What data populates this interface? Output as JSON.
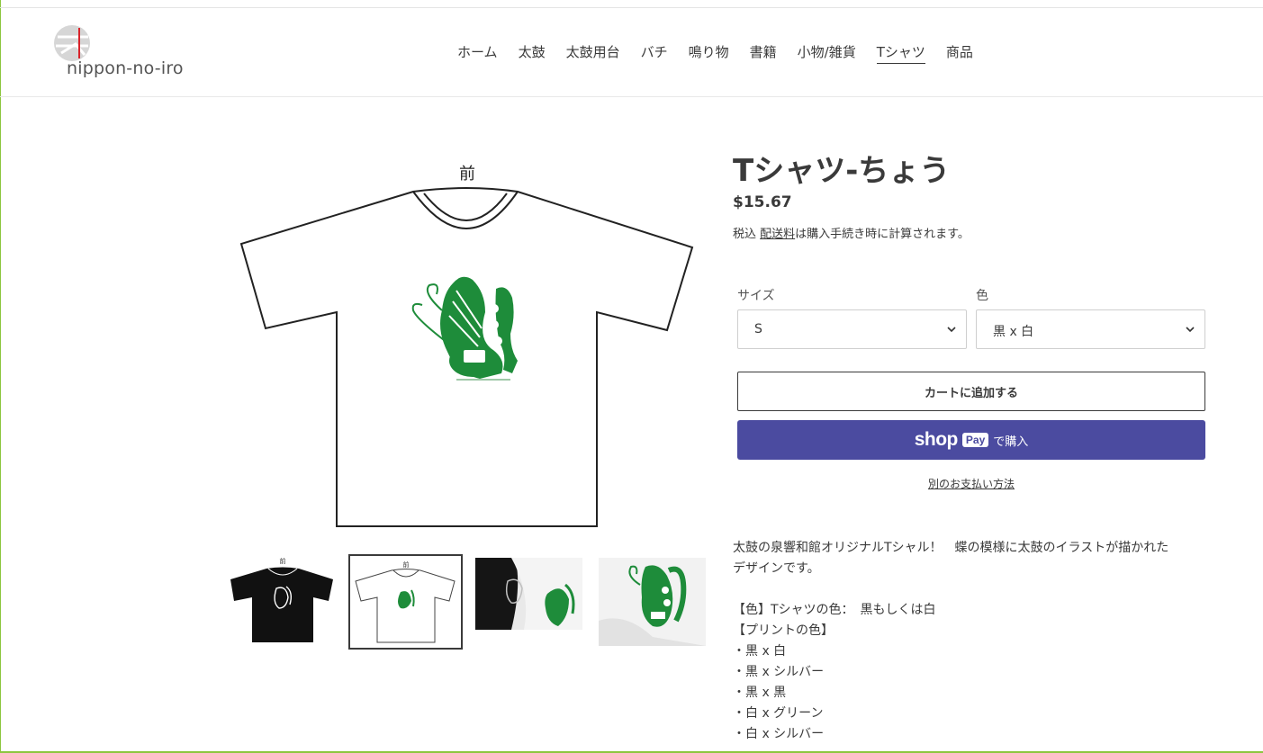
{
  "header": {
    "logo_text": "nippon-no-iro",
    "nav": [
      {
        "label": "ホーム"
      },
      {
        "label": "太鼓"
      },
      {
        "label": "太鼓用台"
      },
      {
        "label": "バチ"
      },
      {
        "label": "鳴り物"
      },
      {
        "label": "書籍"
      },
      {
        "label": "小物/雑貨"
      },
      {
        "label": "Tシャツ",
        "active": true
      },
      {
        "label": "商品"
      }
    ]
  },
  "gallery": {
    "main_caption": "前",
    "thumbnails": [
      {
        "name": "black-shirt-front",
        "selected": false
      },
      {
        "name": "white-shirt-front",
        "selected": true
      },
      {
        "name": "shirts-photo",
        "selected": false
      },
      {
        "name": "print-closeup-photo",
        "selected": false
      }
    ],
    "print_color": "#1e8c3a"
  },
  "product": {
    "title": "Tシャツ-ちょう",
    "price": "$15.67",
    "tax_prefix": "税込 ",
    "tax_link": "配送料",
    "tax_suffix": "は購入手続き時に計算されます。",
    "options": {
      "size_label": "サイズ",
      "size_value": "S",
      "color_label": "色",
      "color_value": "黒 x 白"
    },
    "add_to_cart": "カートに追加する",
    "shop_pay": {
      "shop": "shop",
      "pay": "Pay",
      "buy": "で購入"
    },
    "more_payment": "別のお支払い方法"
  },
  "description": {
    "lines": [
      " 太鼓の泉響和館オリジナルTシャル！　蝶の模様に太鼓のイラストが描かれた",
      "デザインです。",
      "",
      "【色】Tシャツの色：　黒もしくは白",
      "【プリントの色】",
      "・黒 x 白",
      "・黒 x シルバー",
      "・黒 x 黒",
      "・白 x グリーン",
      "・白 x シルバー"
    ]
  },
  "colors": {
    "accent": "#4b4ba0",
    "frame": "#8cc63f",
    "text": "#3a3a3a"
  }
}
